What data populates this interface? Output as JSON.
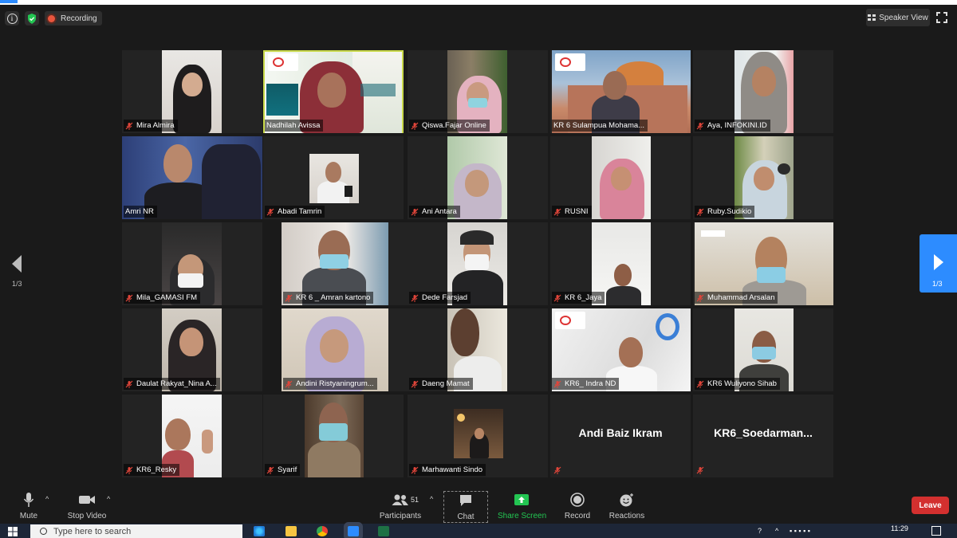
{
  "topbar": {
    "recording_label": "Recording",
    "speaker_view_label": "Speaker View"
  },
  "participants": [
    {
      "name": "Mira Almira",
      "muted": true
    },
    {
      "name": "Nadhilah Avissa",
      "muted": false,
      "active_speaker": true
    },
    {
      "name": "Qiswa.Fajar Online",
      "muted": true
    },
    {
      "name": "KR 6 Sulampua Mohama...",
      "muted": false
    },
    {
      "name": "Aya, INFOKINI.ID",
      "muted": true
    },
    {
      "name": "Amri NR",
      "muted": false
    },
    {
      "name": "Abadi Tamrin",
      "muted": true
    },
    {
      "name": "Ani Antara",
      "muted": true
    },
    {
      "name": "RUSNI",
      "muted": true
    },
    {
      "name": "Ruby.Sudikio",
      "muted": true
    },
    {
      "name": "Mila_GAMASI FM",
      "muted": true
    },
    {
      "name": "KR 6 _ Amran kartono",
      "muted": true
    },
    {
      "name": "Dede Farsjad",
      "muted": true
    },
    {
      "name": "KR 6_Jaya",
      "muted": true
    },
    {
      "name": "Muhammad Arsalan",
      "muted": true
    },
    {
      "name": "Daulat Rakyat_Nina A...",
      "muted": true
    },
    {
      "name": "Andini Ristyaningrum...",
      "muted": true
    },
    {
      "name": "Daeng Mamat",
      "muted": true
    },
    {
      "name": "KR6_ Indra ND",
      "muted": true
    },
    {
      "name": "KR6 Wuliyono Sihab",
      "muted": true
    },
    {
      "name": "KR6_Resky",
      "muted": true
    },
    {
      "name": "Syarif",
      "muted": true
    },
    {
      "name": "Marhawanti Sindo",
      "muted": true
    },
    {
      "name": "Andi Baiz Ikram",
      "muted": true,
      "video_off": true
    },
    {
      "name": "KR6_Soedarman...",
      "muted": true,
      "video_off": true
    }
  ],
  "pagination": {
    "left": "1/3",
    "right": "1/3"
  },
  "toolbar": {
    "mute": "Mute",
    "stop_video": "Stop Video",
    "participants": "Participants",
    "participants_count": "51",
    "chat": "Chat",
    "share_screen": "Share Screen",
    "record": "Record",
    "reactions": "Reactions",
    "leave": "Leave"
  },
  "taskbar": {
    "search_placeholder": "Type here to search",
    "time": "11:29"
  },
  "colors": {
    "zoom_blue": "#2d8cff",
    "share_green": "#23c552",
    "leave_red": "#d3302f",
    "active_speaker_border": "#c9d94a",
    "muted_red": "#e0453a"
  }
}
